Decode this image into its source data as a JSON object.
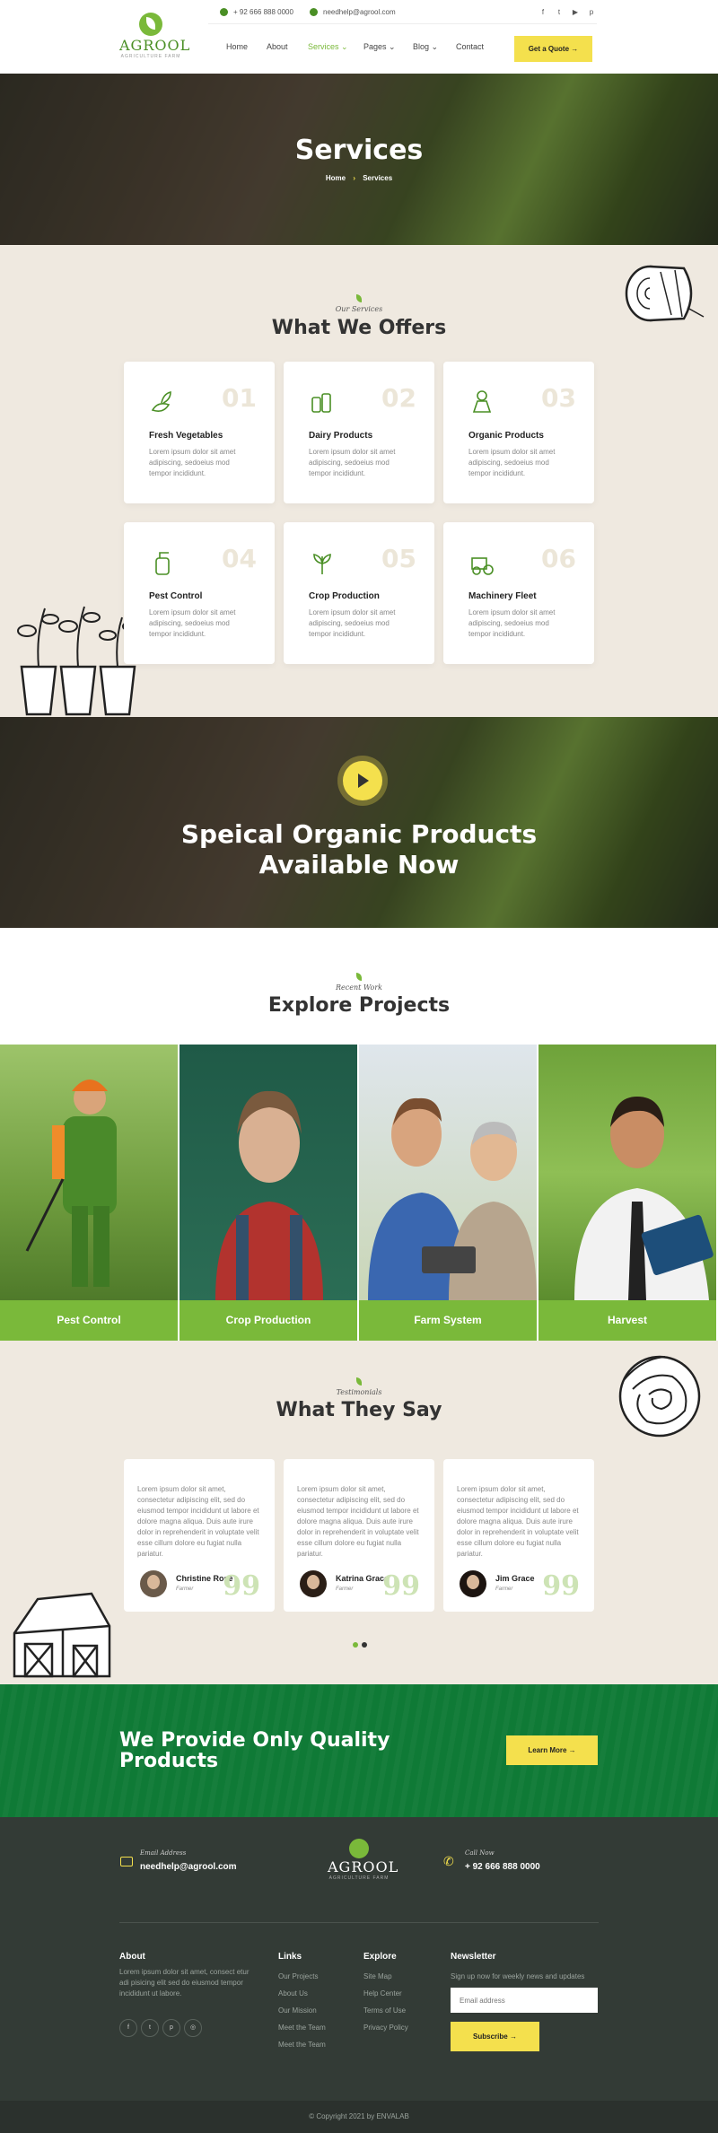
{
  "colors": {
    "brand_green": "#7ab93a",
    "accent_yellow": "#f4e04d",
    "dark_green": "#0f7a36",
    "footer_bg": "#333b36",
    "cream": "#efe9e0"
  },
  "header": {
    "logo_name": "AGROOL",
    "logo_tagline": "AGRICULTURE FARM",
    "phone": "+ 92 666 888 0000",
    "email": "needhelp@agrool.com",
    "social_icons": [
      "facebook-icon",
      "twitter-icon",
      "youtube-icon",
      "pinterest-icon"
    ],
    "social_glyphs": [
      "f",
      "t",
      "▶",
      "p"
    ],
    "nav": [
      "Home",
      "About",
      "Services",
      "Pages",
      "Blog",
      "Contact"
    ],
    "nav_active": "Services",
    "quote_button": "Get a Quote"
  },
  "hero": {
    "title": "Services",
    "breadcrumb_home": "Home",
    "breadcrumb_sep": "›",
    "breadcrumb_current": "Services"
  },
  "offers": {
    "subtitle": "Our Services",
    "title": "What We Offers",
    "cards": [
      {
        "num": "01",
        "title": "Fresh Vegetables",
        "text": "Lorem ipsum dolor sit amet adipiscing, sedoeius mod tempor incididunt.",
        "icon": "vegetables-icon"
      },
      {
        "num": "02",
        "title": "Dairy Products",
        "text": "Lorem ipsum dolor sit amet adipiscing, sedoeius mod tempor incididunt.",
        "icon": "dairy-icon"
      },
      {
        "num": "03",
        "title": "Organic Products",
        "text": "Lorem ipsum dolor sit amet adipiscing, sedoeius mod tempor incididunt.",
        "icon": "organic-icon"
      },
      {
        "num": "04",
        "title": "Pest Control",
        "text": "Lorem ipsum dolor sit amet adipiscing, sedoeius mod tempor incididunt.",
        "icon": "pest-spray-icon"
      },
      {
        "num": "05",
        "title": "Crop Production",
        "text": "Lorem ipsum dolor sit amet adipiscing, sedoeius mod tempor incididunt.",
        "icon": "crop-icon"
      },
      {
        "num": "06",
        "title": "Machinery Fleet",
        "text": "Lorem ipsum dolor sit amet adipiscing, sedoeius mod tempor incididunt.",
        "icon": "tractor-icon"
      }
    ]
  },
  "promo": {
    "line1": "Speical Organic Products",
    "line2": "Available Now"
  },
  "projects": {
    "subtitle": "Recent Work",
    "title": "Explore Projects",
    "items": [
      "Pest Control",
      "Crop Production",
      "Farm System",
      "Harvest"
    ]
  },
  "testimonials": {
    "subtitle": "Testimonials",
    "title": "What They Say",
    "items": [
      {
        "text": "Lorem ipsum dolor sit amet, consectetur adipiscing elit, sed do eiusmod tempor incididunt ut labore et dolore magna aliqua. Duis aute irure dolor in reprehenderit in voluptate velit esse cillum dolore eu fugiat nulla pariatur.",
        "name": "Christine Rose",
        "role": "Farmer"
      },
      {
        "text": "Lorem ipsum dolor sit amet, consectetur adipiscing elit, sed do eiusmod tempor incididunt ut labore et dolore magna aliqua. Duis aute irure dolor in reprehenderit in voluptate velit esse cillum dolore eu fugiat nulla pariatur.",
        "name": "Katrina Grace",
        "role": "Farmer"
      },
      {
        "text": "Lorem ipsum dolor sit amet, consectetur adipiscing elit, sed do eiusmod tempor incididunt ut labore et dolore magna aliqua. Duis aute irure dolor in reprehenderit in voluptate velit esse cillum dolore eu fugiat nulla pariatur.",
        "name": "Jim Grace",
        "role": "Farmer"
      }
    ],
    "quote_glyph": "99"
  },
  "quality": {
    "line1": "We Provide Only Quality",
    "line2": "Products",
    "button": "Learn More"
  },
  "footer": {
    "email_label": "Email Address",
    "email_value": "needhelp@agrool.com",
    "call_label": "Call Now",
    "call_value": "+ 92 666 888 0000",
    "about_title": "About",
    "about_text": "Lorem ipsum dolor sit amet, consect etur adi pisicing elit sed do eiusmod tempor incididunt ut labore.",
    "links_title": "Links",
    "links": [
      "Our Projects",
      "About Us",
      "Our Mission",
      "Meet the Team",
      "Meet the Team"
    ],
    "explore_title": "Explore",
    "explore": [
      "Site Map",
      "Help Center",
      "Terms of Use",
      "Privacy Policy"
    ],
    "newsletter_title": "Newsletter",
    "newsletter_text": "Sign up now for weekly news and updates",
    "email_placeholder": "Email address",
    "subscribe_button": "Subscribe",
    "social_glyphs": [
      "f",
      "t",
      "p",
      "◎"
    ]
  },
  "copyright": "© Copyright 2021 by ENVALAB"
}
